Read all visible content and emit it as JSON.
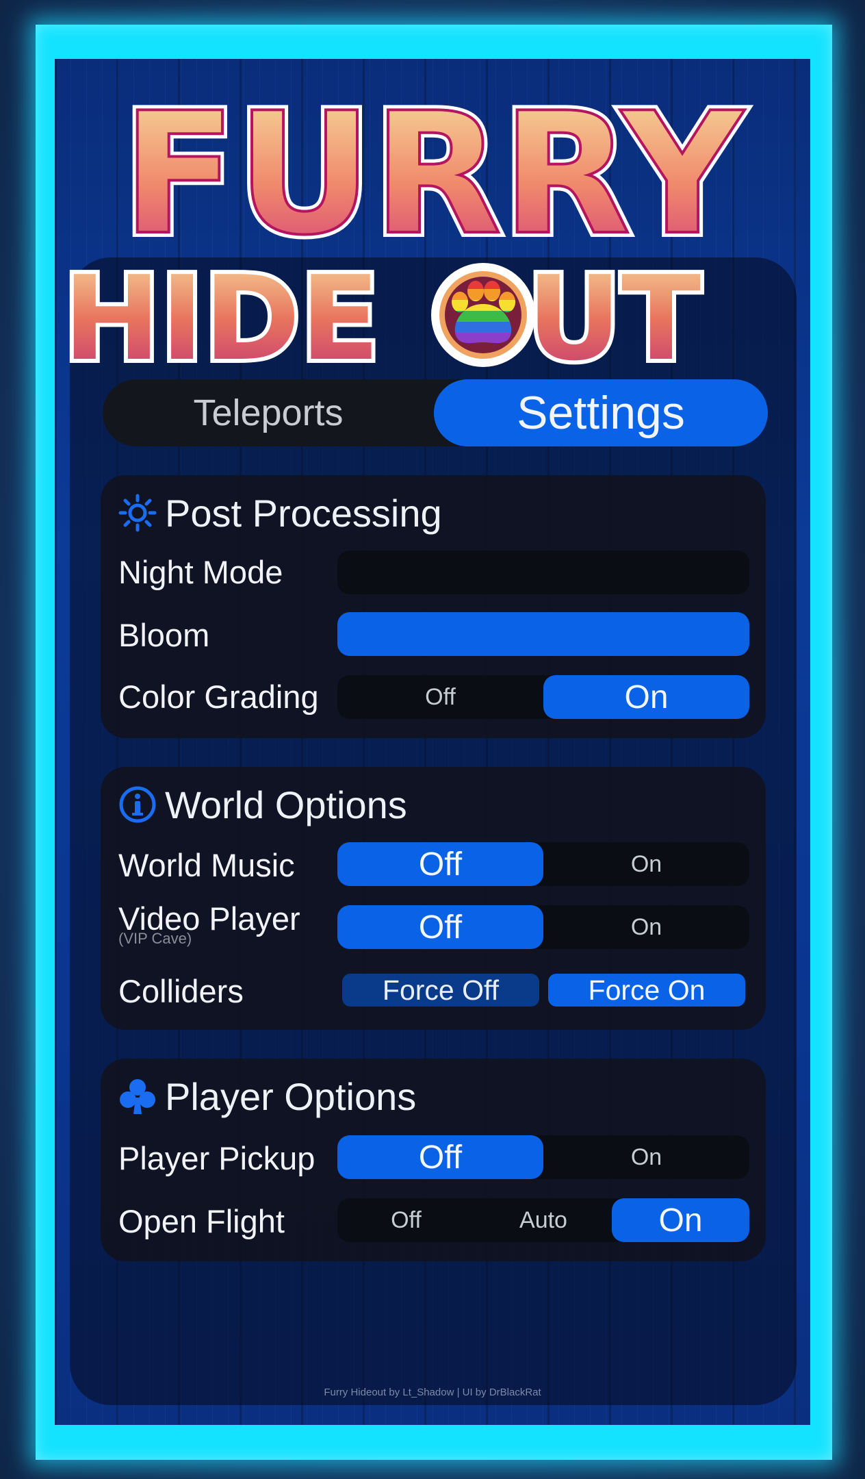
{
  "logo": {
    "line1": "FURRY",
    "line2_a": "HIDE",
    "line2_b": "UT"
  },
  "tabs": [
    {
      "label": "Teleports",
      "active": false
    },
    {
      "label": "Settings",
      "active": true
    }
  ],
  "sections": {
    "post_processing": {
      "title": "Post Processing",
      "icon": "sun-icon",
      "rows": {
        "night_mode": {
          "label": "Night Mode"
        },
        "bloom": {
          "label": "Bloom",
          "level": 1.0
        },
        "color_grading": {
          "label": "Color Grading",
          "off": "Off",
          "on": "On",
          "selected": "On"
        }
      }
    },
    "world_options": {
      "title": "World Options",
      "icon": "info-icon",
      "rows": {
        "world_music": {
          "label": "World Music",
          "off": "Off",
          "on": "On",
          "selected": "Off"
        },
        "video_player": {
          "label": "Video Player",
          "sub": "(VIP Cave)",
          "off": "Off",
          "on": "On",
          "selected": "Off"
        },
        "colliders": {
          "label": "Colliders",
          "force_off": "Force Off",
          "force_on": "Force On"
        }
      }
    },
    "player_options": {
      "title": "Player Options",
      "icon": "club-icon",
      "rows": {
        "player_pickup": {
          "label": "Player Pickup",
          "off": "Off",
          "on": "On",
          "selected": "Off"
        },
        "open_flight": {
          "label": "Open Flight",
          "off": "Off",
          "auto": "Auto",
          "on": "On",
          "selected": "On"
        }
      }
    }
  },
  "footer": "Furry Hideout by Lt_Shadow | UI by DrBlackRat",
  "colors": {
    "accent": "#0a63e6",
    "frame": "#14e3ff",
    "panel": "#10121c"
  }
}
